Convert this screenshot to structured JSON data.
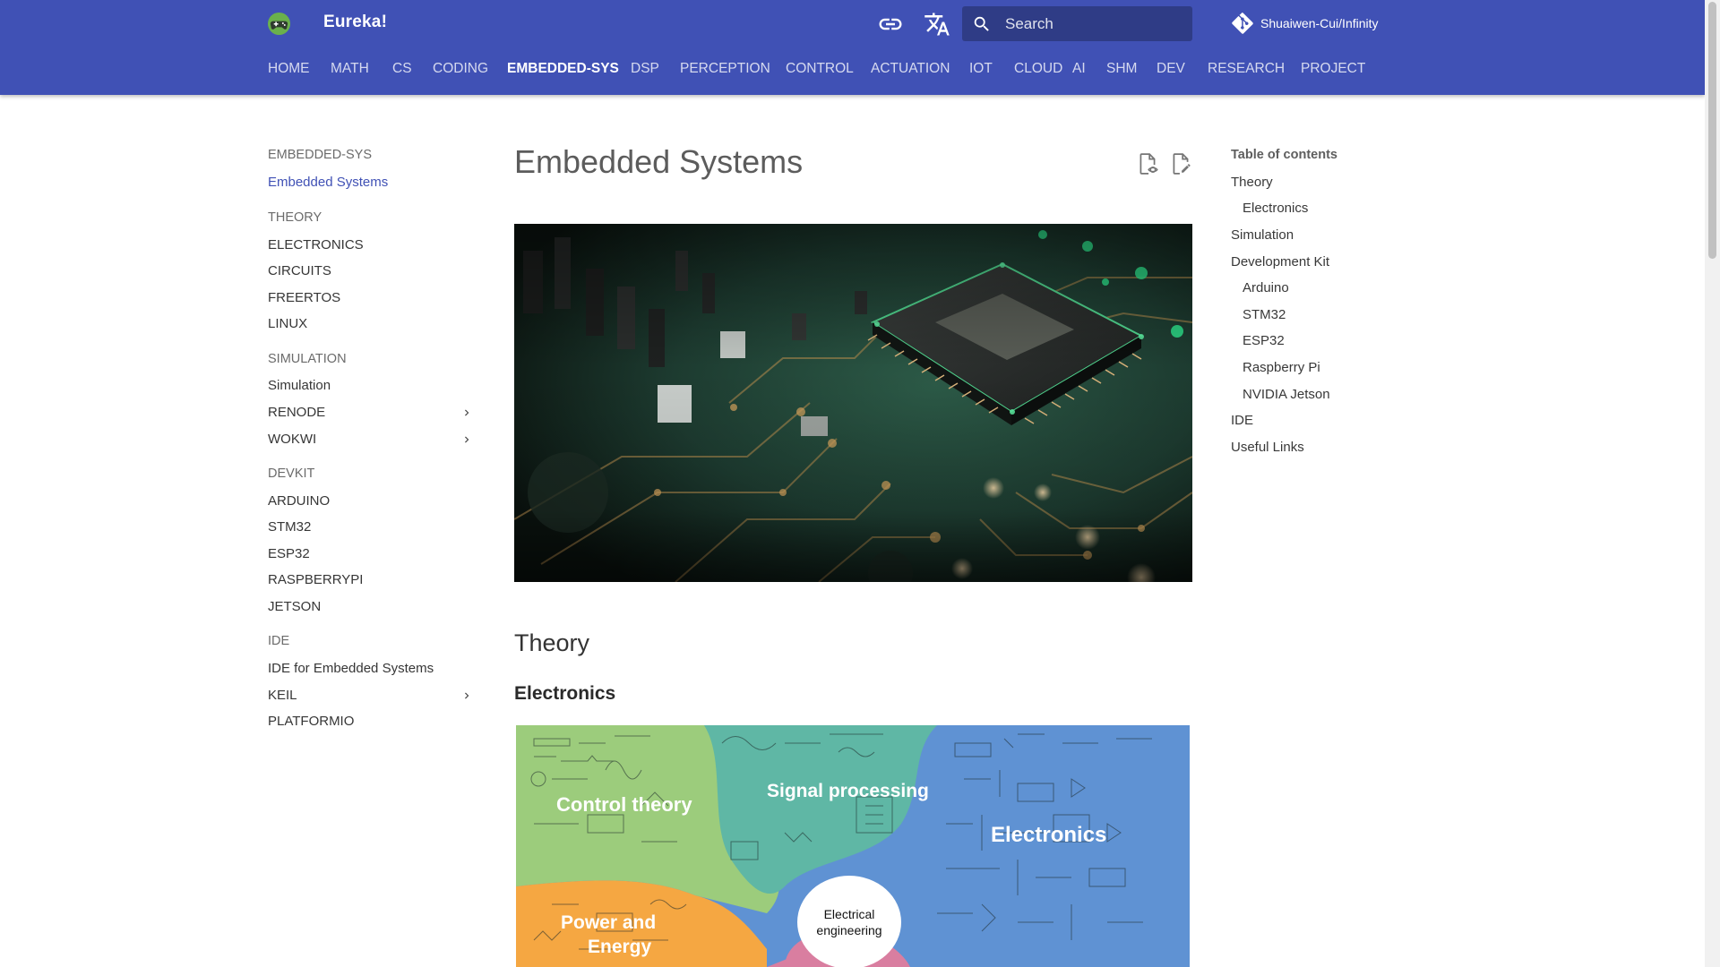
{
  "header": {
    "site_title": "Eureka!",
    "search": {
      "placeholder": "Search"
    },
    "repo_label": "Shuaiwen-Cui/Infinity",
    "icons": [
      "gamepad-logo-icon",
      "link-icon",
      "translate-icon",
      "search-icon",
      "git-icon"
    ],
    "color": "#4051b5"
  },
  "tabs": [
    {
      "label": "HOME"
    },
    {
      "label": "MATH"
    },
    {
      "label": "CS"
    },
    {
      "label": "CODING"
    },
    {
      "label": "EMBEDDED-SYS",
      "active": true
    },
    {
      "label": "DSP"
    },
    {
      "label": "PERCEPTION"
    },
    {
      "label": "CONTROL"
    },
    {
      "label": "ACTUATION"
    },
    {
      "label": "IOT"
    },
    {
      "label": "CLOUD"
    },
    {
      "label": "AI"
    },
    {
      "label": "SHM"
    },
    {
      "label": "DEV"
    },
    {
      "label": "RESEARCH"
    },
    {
      "label": "PROJECT"
    }
  ],
  "leftnav": {
    "section_title": "EMBEDDED-SYS",
    "current_page": "Embedded Systems",
    "theory": {
      "title": "THEORY",
      "items": [
        "ELECTRONICS",
        "CIRCUITS",
        "FREERTOS",
        "LINUX"
      ]
    },
    "simulation": {
      "title": "SIMULATION",
      "items": [
        "Simulation",
        "RENODE",
        "WOKWI"
      ]
    },
    "devkit": {
      "title": "DEVKIT",
      "items": [
        "ARDUINO",
        "STM32",
        "ESP32",
        "RASPBERRYPI",
        "JETSON"
      ]
    },
    "ide": {
      "title": "IDE",
      "items": [
        "IDE for Embedded Systems",
        "KEIL",
        "PLATFORMIO"
      ]
    }
  },
  "main": {
    "title": "Embedded Systems",
    "hero_image": "circuit-board-chip",
    "h2_theory": "Theory",
    "h3_electronics": "Electronics",
    "mindmap": {
      "control": "Control theory",
      "signal": "Signal processing",
      "electronics": "Electronics",
      "power_line1": "Power and",
      "power_line2": "Energy",
      "center_line1": "Electrical",
      "center_line2": "engineering"
    }
  },
  "toc": {
    "title": "Table of contents",
    "items": [
      "Theory",
      "Electronics",
      "Simulation",
      "Development Kit",
      "Arduino",
      "STM32",
      "ESP32",
      "Raspberry Pi",
      "NVIDIA Jetson",
      "IDE",
      "Useful Links"
    ]
  }
}
